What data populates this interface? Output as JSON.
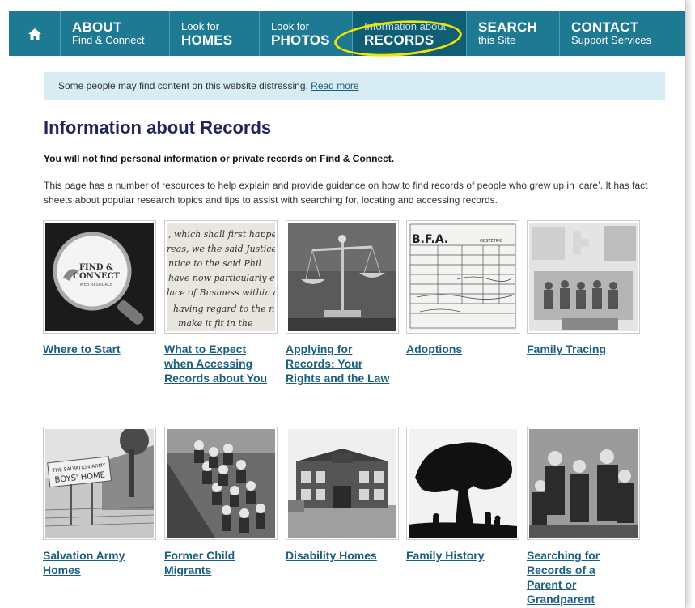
{
  "nav": {
    "home_icon": "home-icon",
    "items": [
      {
        "line1": "ABOUT",
        "line2": "Find & Connect"
      },
      {
        "line1": "Look for",
        "line2": "HOMES"
      },
      {
        "line1": "Look for",
        "line2": "PHOTOS"
      },
      {
        "line1": "Information about",
        "line2": "RECORDS"
      },
      {
        "line1": "SEARCH",
        "line2": "this Site"
      },
      {
        "line1": "CONTACT",
        "line2": "Support Services"
      }
    ],
    "active_color": "#0f5e73",
    "bar_color": "#1e7a92",
    "highlight_color": "#f2e300"
  },
  "notice": {
    "text": "Some people may find content on this website distressing. ",
    "link": "Read more"
  },
  "page": {
    "title": "Information about Records",
    "lead": "You will not find personal information or private records on Find & Connect.",
    "intro": "This page has a number of resources to help explain and provide guidance on how to find records of people who grew up in ‘care’. It has fact sheets about popular research topics and tips to assist with searching for, locating and accessing records."
  },
  "thumb_text": {
    "logo_line1": "FIND &",
    "logo_line2": "CONNECT",
    "logo_line3": "WEB RESOURCE",
    "script_line1": ", which shall first happen",
    "script_line2": "reas, we the said Justices",
    "script_line3": "ntice to the said Phil",
    "script_line4": "have now particularly en",
    "script_line5": "lace of Business within a",
    "script_line6": "having regard to the n",
    "script_line7": "make it fit in the",
    "form_stamp": "B.F.A.",
    "form_heading": "OBSTETRIC",
    "sign_line1": "THE SALVATION ARMY",
    "sign_line2": "BOYS' HOME"
  },
  "tiles": [
    {
      "label": "Where to Start"
    },
    {
      "label": "What to Expect when Accessing Records about You"
    },
    {
      "label": "Applying for Records: Your Rights and the Law"
    },
    {
      "label": "Adoptions"
    },
    {
      "label": "Family Tracing"
    },
    {
      "label": "Salvation Army Homes"
    },
    {
      "label": "Former Child Migrants"
    },
    {
      "label": "Disability Homes"
    },
    {
      "label": "Family History"
    },
    {
      "label": "Searching for Records of a Parent or Grandparent"
    }
  ]
}
